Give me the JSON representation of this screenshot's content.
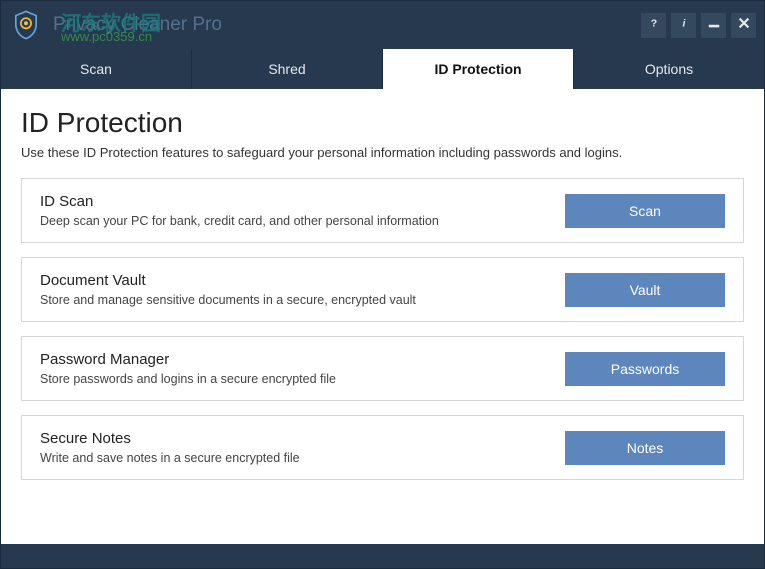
{
  "app": {
    "title": "Privacy Cleaner Pro",
    "watermark_top": "河东软件园",
    "watermark_bottom": "www.pc0359.cn"
  },
  "tabs": [
    {
      "label": "Scan"
    },
    {
      "label": "Shred"
    },
    {
      "label": "ID Protection"
    },
    {
      "label": "Options"
    }
  ],
  "page": {
    "title": "ID Protection",
    "subtitle": "Use these ID Protection features to safeguard your personal information including passwords and logins."
  },
  "cards": [
    {
      "title": "ID Scan",
      "desc": "Deep scan your PC for bank, credit card, and other personal information",
      "button": "Scan"
    },
    {
      "title": "Document Vault",
      "desc": "Store and manage sensitive documents in a secure, encrypted vault",
      "button": "Vault"
    },
    {
      "title": "Password Manager",
      "desc": "Store passwords and logins in a secure encrypted file",
      "button": "Passwords"
    },
    {
      "title": "Secure Notes",
      "desc": "Write and save notes in a secure encrypted file",
      "button": "Notes"
    }
  ]
}
